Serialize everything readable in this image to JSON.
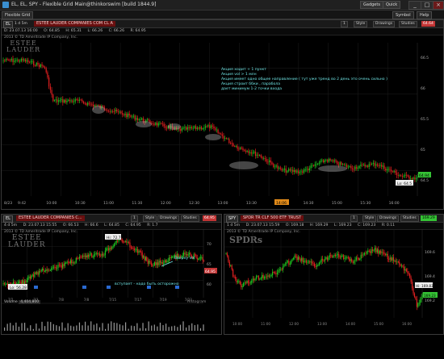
{
  "window": {
    "title": "EL, EL, SPY - Flexible Grid Main@thinkorswim [build 1844.9]",
    "buttons": [
      "Gadgets",
      "Quick",
      "Symbol",
      "Help"
    ]
  },
  "grid_tab": "Flexible Grid",
  "main": {
    "symbol": "EL",
    "timeframe": "1 d 5m",
    "description": "ESTEE LAUDER COMPANIES COM CL A",
    "last_price": "64.64",
    "ohlc": [
      "D: 23.07.13 16:00",
      "O: 64.85",
      "H: 65.31",
      "L: 66.26",
      "C: 66.26",
      "R: 64.95"
    ],
    "copyright": "2013 © TD Ameritrade IP Company, Inc.",
    "logo_line1": "ESTEE",
    "logo_line2": "LAUDER",
    "y_ticks": [
      "66.5",
      "66",
      "65.5",
      "65",
      "64.5"
    ],
    "x_ticks": [
      "9:42",
      "10:00",
      "10:30",
      "11:00",
      "11:30",
      "12:00",
      "12:30",
      "13:00",
      "13:30",
      "14:00",
      "14:30",
      "15:00",
      "15:30",
      "16:00"
    ],
    "x_start_label": "8/23",
    "highlight_time": "14:06",
    "annotations": [
      "Акция ходит + 1 пункт",
      "Акция vol > 1 млн",
      "Акция имеет одно общее направление ( тут уже тренд во 2 день это очень сильно )",
      "Акция строит ббки , парабола",
      "дает минимум 1-2 точки входа"
    ],
    "low_label": "Lo: 64.5",
    "side_price": "64.94",
    "toolbar": [
      "Style",
      "Drawings",
      "Studies"
    ],
    "toolbar_qty": "1"
  },
  "left_panel": {
    "symbol": "EL",
    "description": "ESTEE LAUDER COMPANIES C...",
    "last_price": "64.95",
    "timeframe": "4 d 5m",
    "ohlc": [
      "D: 23.07.13 15:55",
      "O: 66.53",
      "H: 66.6",
      "L: 64.85",
      "C: 64.95",
      "R: 1.7"
    ],
    "copyright": "2013 © TD Ameritrade IP Company, Inc.",
    "logo_line1": "ESTEE",
    "logo_line2": "LAUDER",
    "hi_label": "Hi: 72.7",
    "low_label": "Lo: 56.28",
    "side_price": "64.95",
    "annotations": [
      "Вверху Vol",
      "вступает - надо быть осторожно"
    ],
    "y_ticks": [
      "70",
      "65",
      "60"
    ],
    "x_ticks": [
      "7/2",
      "7/1",
      "7/8",
      "7/8",
      "7/15",
      "7/17",
      "7/19",
      "7/23"
    ],
    "volume_label": "Volume",
    "volume_value": "4,404,800",
    "volume_right": "Histogram",
    "toolbar": [
      "Style",
      "Drawings",
      "Studies"
    ],
    "toolbar_qty": "1"
  },
  "right_panel": {
    "symbol": "SPY",
    "description": "SPDR TR CLF 500 ETF TRUST",
    "last_price": "169.29",
    "timeframe": "1 d 5m",
    "ohlc": [
      "D: 23.07.13 15:59",
      "O: 169.18",
      "H: 169.29",
      "L: 169.23",
      "C: 169.23",
      "R: 0.11"
    ],
    "copyright": "2013 © TD Ameritrade IP Company, Inc.",
    "logo_text": "SPDRs",
    "hi_label": "Hi: 169.83",
    "side_price": "169.23",
    "y_ticks": [
      "169.6",
      "169.4",
      "169.2"
    ],
    "x_ticks": [
      "10:00",
      "11:00",
      "12:00",
      "13:00",
      "14:00",
      "15:00",
      "16:00"
    ],
    "toolbar": [
      "Style",
      "Drawings",
      "Studies"
    ],
    "toolbar_qty": "1"
  },
  "colors": {
    "up": "#1fc01f",
    "down": "#e02020",
    "annotation": "#6fe3e3",
    "header_red": "#6a1010",
    "price_green": "#35c335",
    "price_red": "#c33535"
  }
}
